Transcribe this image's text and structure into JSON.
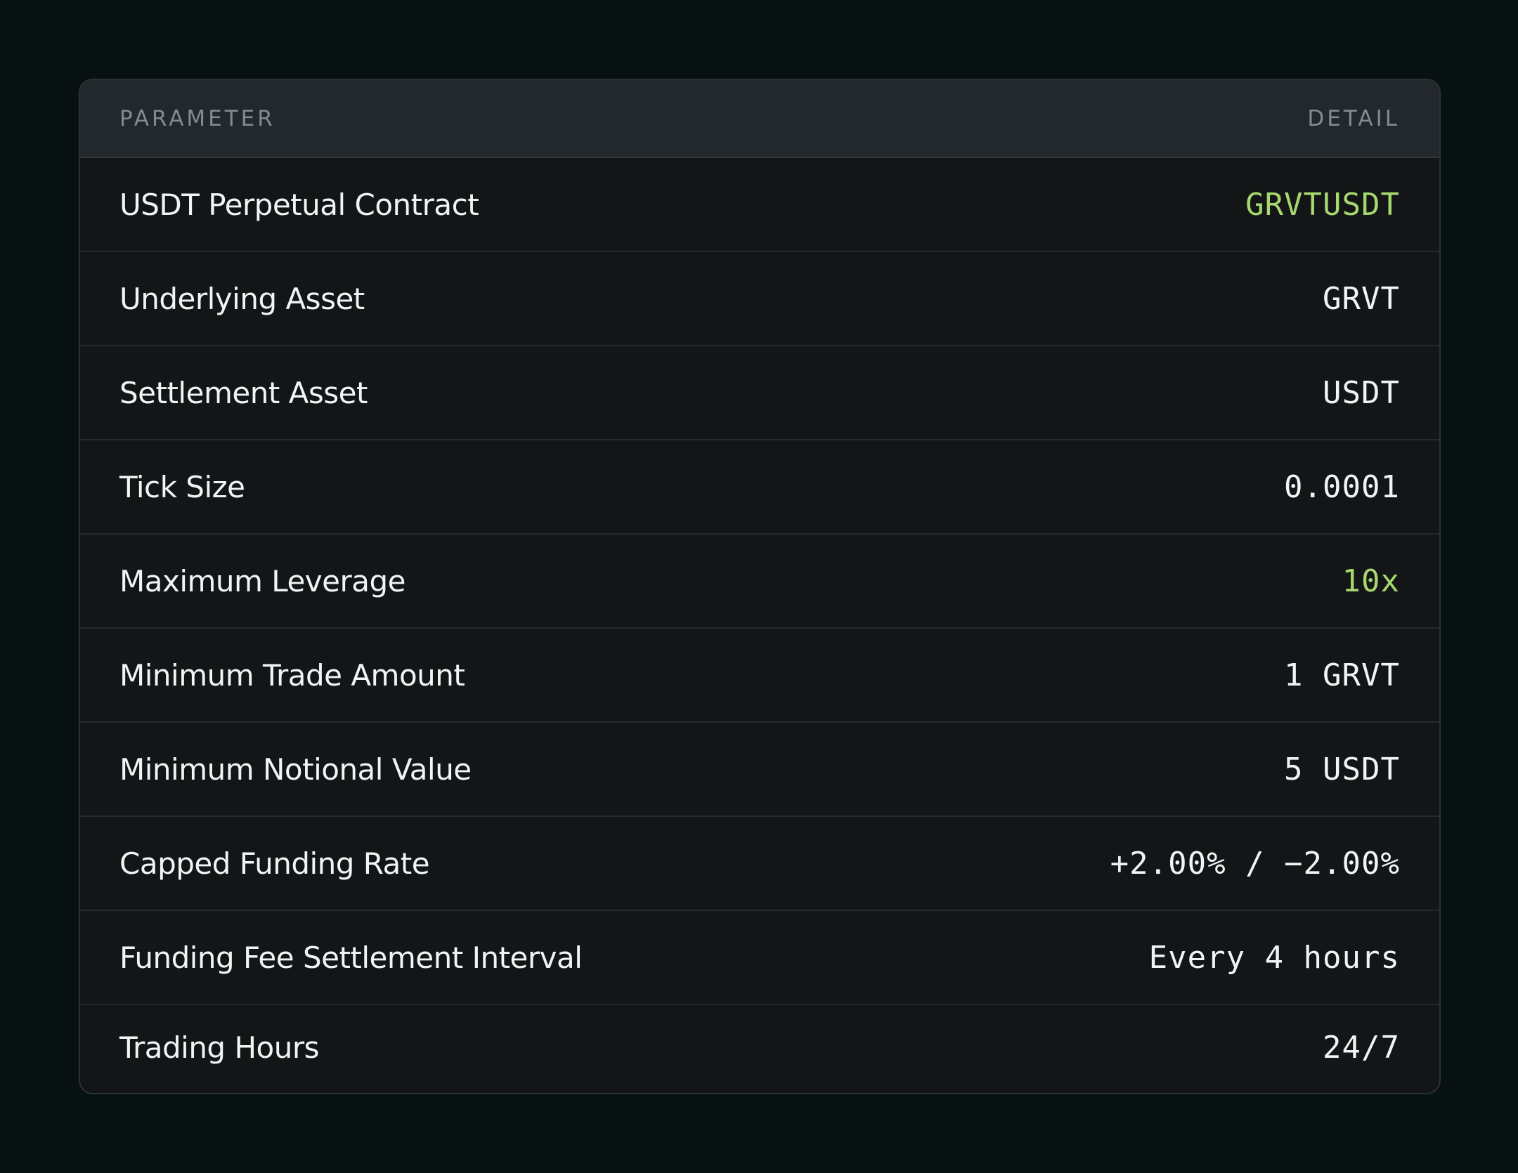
{
  "colors": {
    "background": "#081112",
    "card": "#131517",
    "header": "#23282c",
    "accent": "#a6d86f",
    "text": "#f1f3f4",
    "muted": "#7f8c90"
  },
  "table": {
    "header": {
      "parameter": "PARAMETER",
      "detail": "DETAIL"
    },
    "rows": [
      {
        "label": "USDT Perpetual Contract",
        "value": "GRVTUSDT",
        "accent": true
      },
      {
        "label": "Underlying Asset",
        "value": "GRVT",
        "accent": false
      },
      {
        "label": "Settlement Asset",
        "value": "USDT",
        "accent": false
      },
      {
        "label": "Tick Size",
        "value": "0.0001",
        "accent": false
      },
      {
        "label": "Maximum Leverage",
        "value": "10x",
        "accent": true
      },
      {
        "label": "Minimum Trade Amount",
        "value": "1 GRVT",
        "accent": false
      },
      {
        "label": "Minimum Notional Value",
        "value": "5 USDT",
        "accent": false
      },
      {
        "label": "Capped Funding Rate",
        "value": "+2.00% / −2.00%",
        "accent": false
      },
      {
        "label": "Funding Fee Settlement Interval",
        "value": "Every 4 hours",
        "accent": false
      },
      {
        "label": "Trading Hours",
        "value": "24/7",
        "accent": false
      }
    ]
  }
}
